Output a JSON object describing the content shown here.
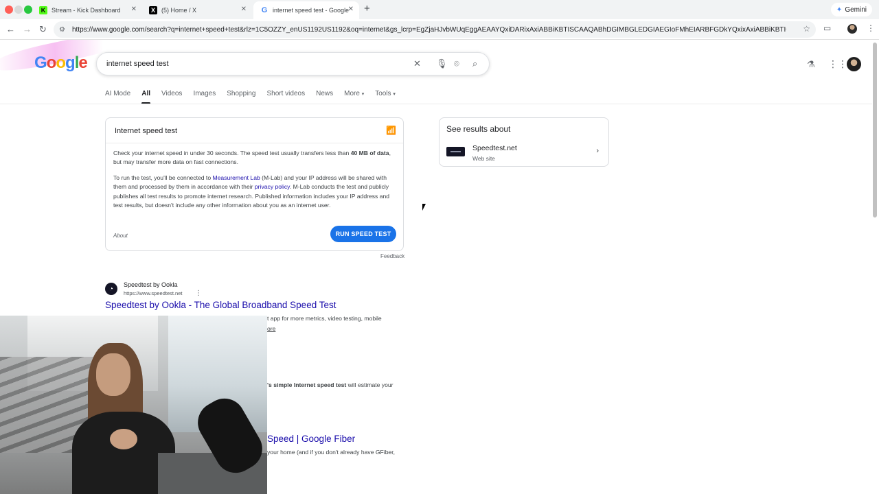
{
  "browser": {
    "tabs": [
      {
        "title": "Stream - Kick Dashboard",
        "favicon": "K"
      },
      {
        "title": "(5) Home / X",
        "favicon": "X"
      },
      {
        "title": "internet speed test - Google S",
        "favicon": "G"
      }
    ],
    "gemini_label": "Gemini",
    "url": "https://www.google.com/search?q=internet+speed+test&rlz=1C5OZZY_enUS1192US1192&oq=internet&gs_lcrp=EgZjaHJvbWUqEggAEAAYQxiDARixAxiABBiKBTISCAAQABhDGIMBGLEDGIAEGIoFMhEIARBFGDkYQxixAxiABBiKBTIQCAIQLhj..."
  },
  "google": {
    "logo_letters": [
      "G",
      "o",
      "o",
      "g",
      "l",
      "e"
    ],
    "query": "internet speed test",
    "search_tabs": [
      "AI Mode",
      "All",
      "Videos",
      "Images",
      "Shopping",
      "Short videos",
      "News",
      "More",
      "Tools"
    ]
  },
  "speed_card": {
    "title": "Internet speed test",
    "p1_a": "Check your internet speed in under 30 seconds. The speed test usually transfers less than ",
    "p1_bold": "40 MB of data",
    "p1_b": ", but may transfer more data on fast connections.",
    "p2_a": "To run the test, you'll be connected to ",
    "p2_link1": "Measurement Lab",
    "p2_b": " (M-Lab) and your IP address will be shared with them and processed by them in accordance with their ",
    "p2_link2": "privacy policy",
    "p2_c": ". M-Lab conducts the test and publicly publishes all test results to promote internet research. Published information includes your IP address and test results, but doesn't include any other information about you as an internet user.",
    "about": "About",
    "run_button": "RUN SPEED TEST",
    "feedback": "Feedback"
  },
  "knowledge_panel": {
    "heading": "See results about",
    "entity_name": "Speedtest.net",
    "entity_sub": "Web site"
  },
  "results": {
    "r1_site": "Speedtest by Ookla",
    "r1_url": "https://www.speedtest.net",
    "r1_title": "Speedtest by Ookla - The Global Broadband Speed Test",
    "r1_snip1": "t app for more metrics, video testing, mobile",
    "r1_snip2": "ore",
    "r2_snip_bold": "'s simple Internet speed test",
    "r2_snip_rest": " will estimate your",
    "r3_title": "Speed | Google Fiber",
    "r3_snip": "your home (and if you don't already have GFiber,"
  }
}
